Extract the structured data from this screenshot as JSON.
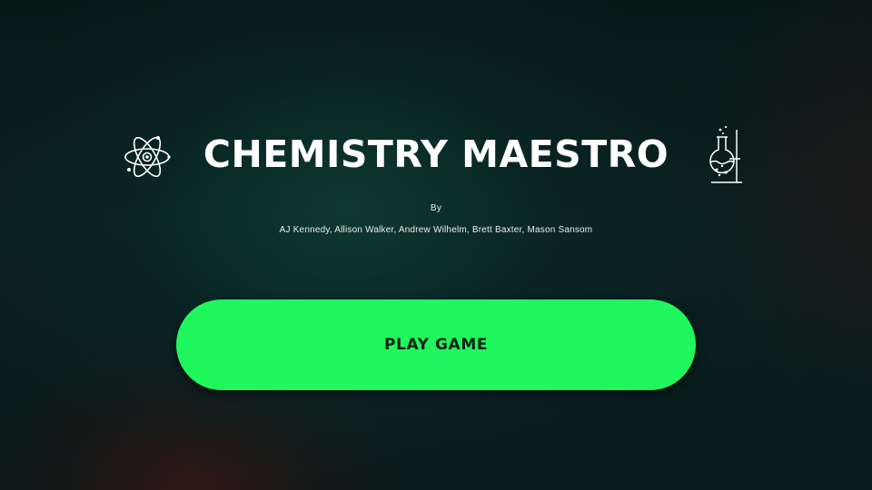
{
  "game": {
    "title": "CHEMISTRY MAESTRO",
    "by_label": "By",
    "authors": "AJ Kennedy, Allison Walker, Andrew Wilhelm, Brett Baxter, Mason Sansom",
    "play_button_label": "PLAY GAME"
  },
  "icons": {
    "left": "atom-icon",
    "right": "flask-icon"
  },
  "colors": {
    "background": "#071a1a",
    "title_text": "#ffffff",
    "play_button": "#1ff75c",
    "play_button_text": "#0f2218"
  }
}
